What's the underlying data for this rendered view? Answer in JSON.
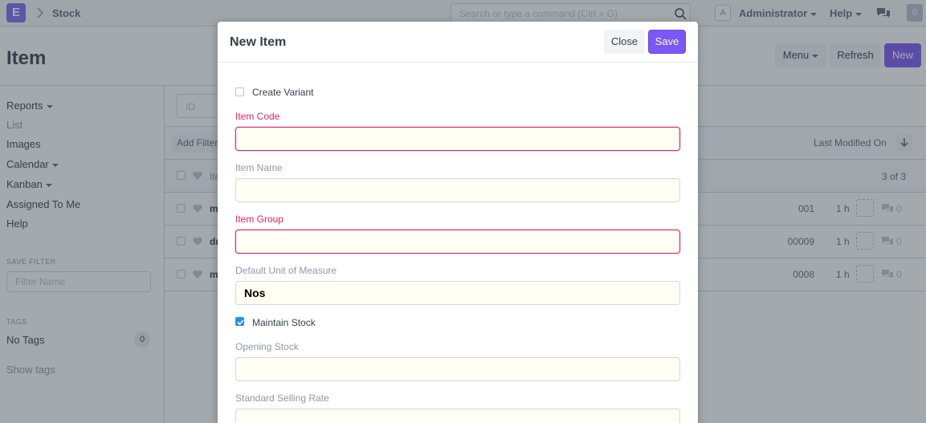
{
  "app": {
    "logo_letter": "E",
    "breadcrumb": "Stock",
    "search_placeholder": "Search or type a command (Ctrl + G)",
    "avatar_letter": "A",
    "user_menu": "Administrator",
    "help_menu": "Help",
    "notification_count": "0"
  },
  "page": {
    "title": "Item",
    "menu_label": "Menu",
    "refresh_label": "Refresh",
    "new_label": "New"
  },
  "sidebar": {
    "items": [
      "Reports",
      "List",
      "Images",
      "Calendar",
      "Kanban",
      "Assigned To Me",
      "Help"
    ],
    "save_filter_heading": "SAVE FILTER",
    "filter_name_placeholder": "Filter Name",
    "tags_heading": "TAGS",
    "no_tags_label": "No Tags",
    "no_tags_count": "0",
    "show_tags_label": "Show tags"
  },
  "list": {
    "id_placeholder": "ID",
    "add_filter_label": "Add Filter",
    "sort_label": "Last Modified On",
    "header_name": "Item Name",
    "count_label": "3 of 3",
    "rows": [
      {
        "name": "ma",
        "code": "001",
        "modified": "1 h",
        "comments": "0"
      },
      {
        "name": "dr",
        "code": "00009",
        "modified": "1 h",
        "comments": "0"
      },
      {
        "name": "ma",
        "code": "0008",
        "modified": "1 h",
        "comments": "0"
      }
    ]
  },
  "modal": {
    "title": "New Item",
    "close_label": "Close",
    "save_label": "Save",
    "create_variant_label": "Create Variant",
    "create_variant_checked": false,
    "item_code_label": "Item Code",
    "item_code_value": "",
    "item_name_label": "Item Name",
    "item_name_value": "",
    "item_group_label": "Item Group",
    "item_group_value": "",
    "uom_label": "Default Unit of Measure",
    "uom_value": "Nos",
    "maintain_stock_label": "Maintain Stock",
    "maintain_stock_checked": true,
    "opening_stock_label": "Opening Stock",
    "opening_stock_value": "",
    "selling_rate_label": "Standard Selling Rate",
    "selling_rate_value": ""
  },
  "colors": {
    "primary": "#7b57f5",
    "required_label": "#e0245e",
    "input_background": "#fffef2",
    "checkbox_checked": "#2490ef"
  }
}
